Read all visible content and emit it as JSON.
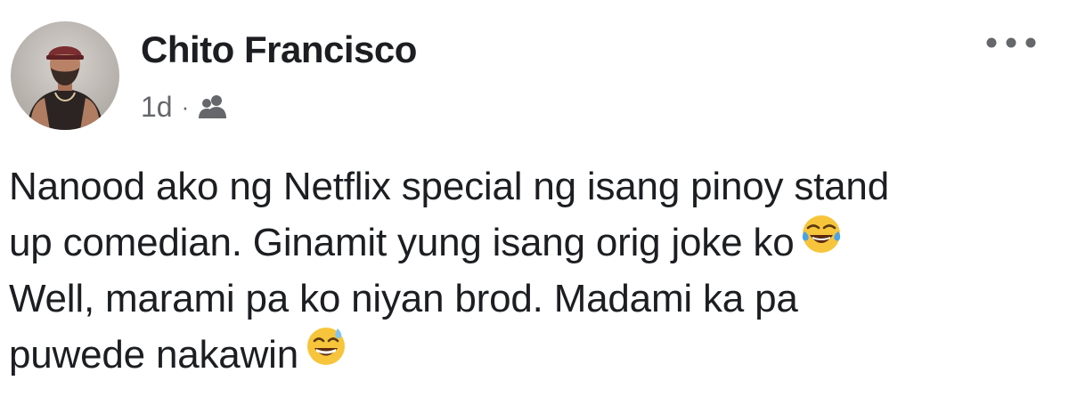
{
  "post": {
    "author": "Chito Francisco",
    "time": "1d",
    "separator": "·",
    "audience_icon": "friends-icon",
    "more_icon": "more-options-icon",
    "text_lines": [
      "Nanood ako ng Netflix special ng isang pinoy stand",
      "up comedian. Ginamit yung isang orig joke ko",
      "Well, marami pa ko niyan brod. Madami ka pa",
      "puwede nakawin"
    ],
    "emojis": [
      {
        "name": "face-with-tears-of-joy-icon",
        "char": "😂"
      },
      {
        "name": "grinning-face-with-sweat-icon",
        "char": "😅"
      }
    ]
  },
  "colors": {
    "text": "#1c1e21",
    "secondary": "#65676b",
    "background": "#ffffff"
  }
}
